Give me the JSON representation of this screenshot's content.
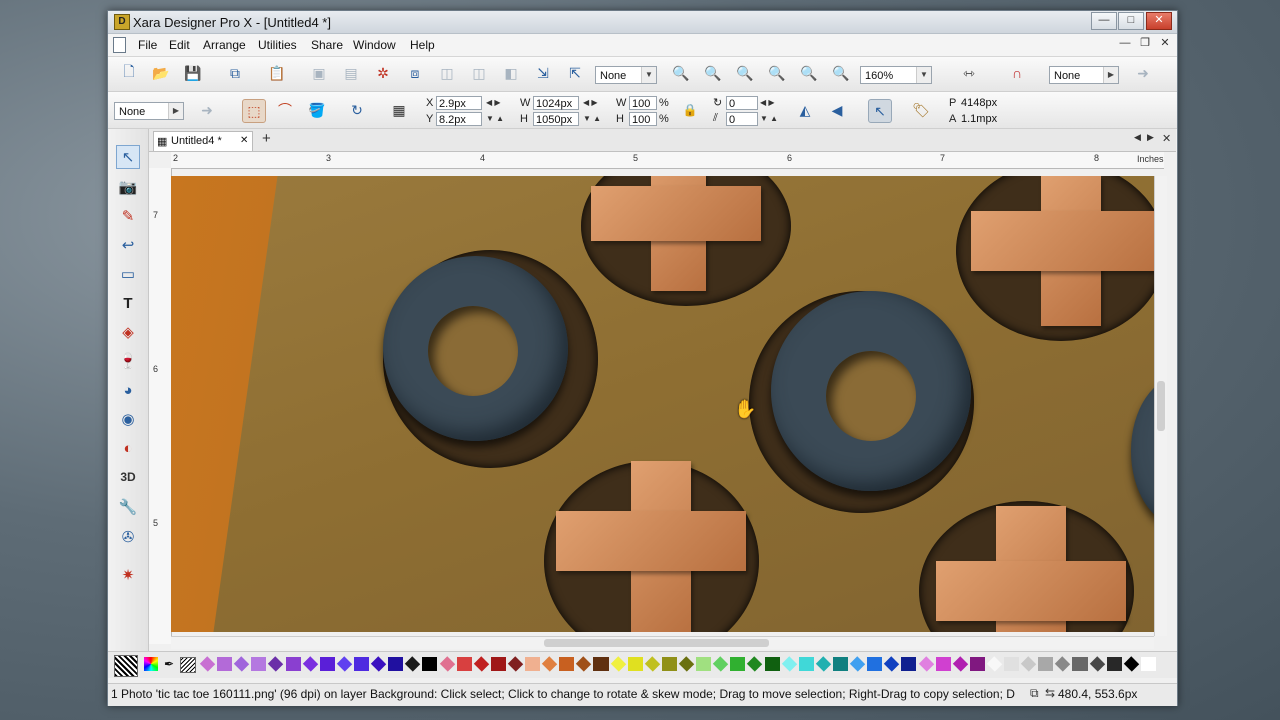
{
  "window": {
    "app_icon": "D",
    "title": "Xara Designer Pro X - [Untitled4 *]",
    "controls": {
      "minimize": "—",
      "maximize": "□",
      "close": "✕"
    }
  },
  "menu": {
    "items": [
      "File",
      "Edit",
      "Arrange",
      "Utilities",
      "Share",
      "Window",
      "Help"
    ],
    "mdi": {
      "minimize": "—",
      "restore": "❐",
      "close": "✕"
    }
  },
  "toolbar1": {
    "quality_combo": "None",
    "zoom_combo": "160%",
    "bevel_combo": "None"
  },
  "toolbar2": {
    "feather_combo": "None",
    "x_label": "X",
    "x_value": "2.9px",
    "y_label": "Y",
    "y_value": "8.2px",
    "w_label": "W",
    "w_value": "1024px",
    "h_label": "H",
    "h_value": "1050px",
    "wp_label": "W",
    "wp_value": "100",
    "hp_label": "H",
    "hp_value": "100",
    "percent": "%",
    "rotate_value": "0",
    "skew_value": "0",
    "p_label": "P",
    "p_value": "4148px",
    "a_label": "A",
    "a_value": "1.1mpx"
  },
  "doc_tab": {
    "label": "Untitled4 *",
    "close": "✕",
    "add": "+"
  },
  "ruler": {
    "h_ticks": [
      "2",
      "3",
      "4",
      "5",
      "6",
      "7",
      "8"
    ],
    "units": "Inches",
    "v_ticks": [
      "7",
      "6",
      "5"
    ]
  },
  "palette": {
    "colors": [
      "#c86fd2",
      "#b36ad8",
      "#a065dc",
      "#b478e0",
      "#6b2fa8",
      "#8a3fd0",
      "#7a2fe0",
      "#5a1fd8",
      "#6040f0",
      "#4e2ae0",
      "#3a10c0",
      "#2010a0",
      "#1a1a1a",
      "#000000",
      "#e07090",
      "#d84040",
      "#c02020",
      "#a01818",
      "#802020",
      "#f0b090",
      "#e08040",
      "#c86020",
      "#a05018",
      "#603010",
      "#f0f040",
      "#e0e020",
      "#c0c020",
      "#909018",
      "#6a7010",
      "#a0e080",
      "#60d060",
      "#30b030",
      "#208820",
      "#106010",
      "#80f0f0",
      "#40d8d8",
      "#20b0b0",
      "#108080",
      "#40a0f0",
      "#2070e0",
      "#1040c0",
      "#102090",
      "#e080e0",
      "#d040d0",
      "#b020b0",
      "#801880",
      "#f8f8f8",
      "#e0e0e0",
      "#c8c8c8",
      "#a8a8a8",
      "#888888",
      "#686868",
      "#484848",
      "#282828",
      "#000000",
      "#ffffff"
    ]
  },
  "status": {
    "message": "1 Photo 'tic tac toe 160111.png' (96 dpi) on layer Background: Click select; Click to change to rotate & skew mode; Drag to move selection; Right-Drag to copy selection; D",
    "coords": "480.4, 553.6px"
  }
}
